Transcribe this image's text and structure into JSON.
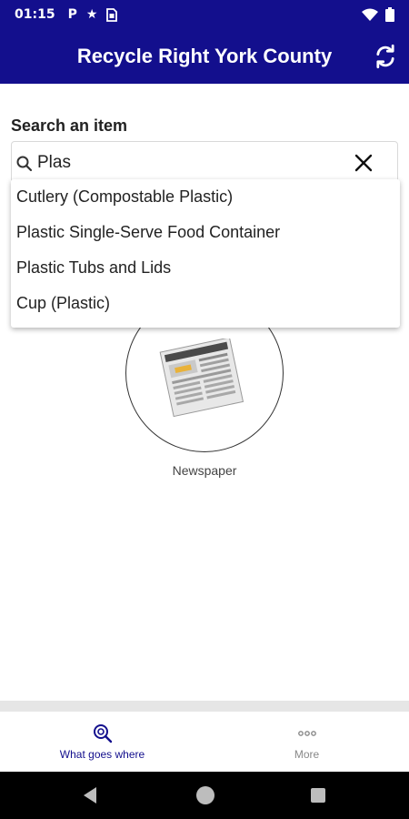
{
  "status_bar": {
    "time": "01:15",
    "icons": [
      "parking-icon",
      "star-icon",
      "sim-card-icon",
      "wifi-icon",
      "battery-icon"
    ]
  },
  "app_bar": {
    "title": "Recycle Right York County",
    "action_icon": "refresh-icon",
    "background": "#130f8d"
  },
  "search": {
    "label": "Search an item",
    "value": "Plas",
    "icon": "search-icon",
    "clear_icon": "close-icon"
  },
  "suggestions": [
    "Cutlery (Compostable Plastic)",
    "Plastic Single-Serve Food Container",
    "Plastic Tubs and Lids",
    "Cup (Plastic)"
  ],
  "featured_item": {
    "label": "Newspaper",
    "icon": "newspaper-image"
  },
  "bottom_nav": {
    "items": [
      {
        "label": "What goes where",
        "icon": "search-item-icon",
        "active": true
      },
      {
        "label": "More",
        "icon": "more-dots-icon",
        "active": false
      }
    ],
    "active_color": "#130f8d",
    "inactive_color": "#888888"
  },
  "system_nav": [
    "back-icon",
    "home-icon",
    "recents-icon"
  ]
}
